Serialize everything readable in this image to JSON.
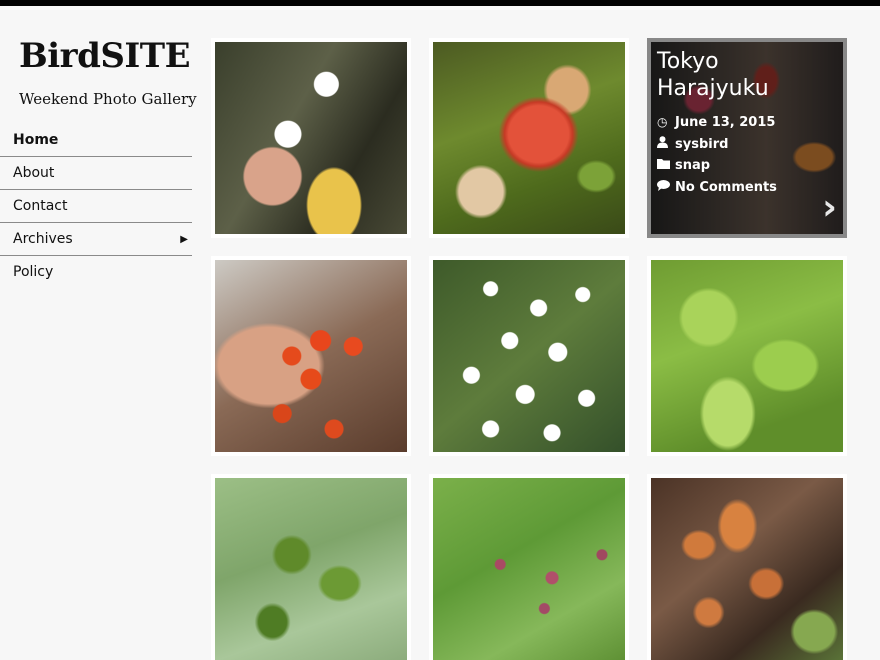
{
  "site": {
    "title": "BirdSITE",
    "description": "Weekend Photo Gallery"
  },
  "nav": [
    {
      "label": "Home",
      "active": true
    },
    {
      "label": "About"
    },
    {
      "label": "Contact"
    },
    {
      "label": "Archives",
      "has_submenu": true
    },
    {
      "label": "Policy"
    }
  ],
  "gallery": {
    "featured": {
      "title_line1": "Tokyo",
      "title_line2": "Harajyuku",
      "date": "June 13, 2015",
      "author": "sysbird",
      "category": "snap",
      "comments": "No Comments",
      "icons": {
        "date": "clock-icon",
        "author": "user-icon",
        "category": "folder-icon",
        "comments": "comment-icon",
        "next": "chevron-right-icon"
      }
    },
    "photos": [
      {
        "subject": "daisies-and-shell"
      },
      {
        "subject": "red-leaf-on-moss"
      },
      {
        "subject": "tokyo-harajyuku"
      },
      {
        "subject": "red-berries-shell"
      },
      {
        "subject": "white-asters"
      },
      {
        "subject": "green-maple-leaves"
      },
      {
        "subject": "wet-leaves"
      },
      {
        "subject": "pink-buds"
      },
      {
        "subject": "bracket-fungus"
      }
    ]
  },
  "colors": {
    "topbar": "#000000",
    "background": "#f7f7f7",
    "divider": "#8a8a8a"
  }
}
